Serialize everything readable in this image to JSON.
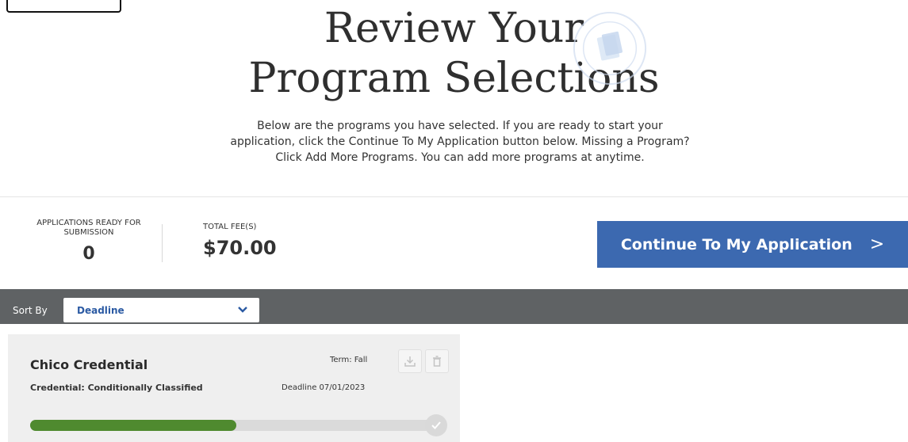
{
  "header": {
    "title_line1": "Review Your",
    "title_line2": "Program Selections",
    "intro": "Below are the programs you have selected. If you are ready to start your application, click the Continue To My Application button below. Missing a Program? Click Add More Programs. You can add more programs at anytime."
  },
  "summary": {
    "ready_label": "APPLICATIONS READY FOR SUBMISSION",
    "ready_value": "0",
    "fee_label": "TOTAL FEE(S)",
    "fee_value": "$70.00"
  },
  "continue_button": {
    "label": "Continue To My Application",
    "chevron": ">"
  },
  "sort": {
    "label": "Sort By",
    "selected": "Deadline"
  },
  "programs": [
    {
      "name": "Chico Credential",
      "subtitle": "Credential: Conditionally Classified",
      "term": "Term: Fall",
      "deadline": "Deadline 07/01/2023",
      "progress": 0.5
    }
  ],
  "colors": {
    "accent": "#3c69b0",
    "sort_bar": "#5f6264",
    "progress": "#4f8a2f"
  },
  "icons": [
    "download-icon",
    "trash-icon",
    "check-icon",
    "chevron-down-icon",
    "program-selections-seal-icon"
  ]
}
